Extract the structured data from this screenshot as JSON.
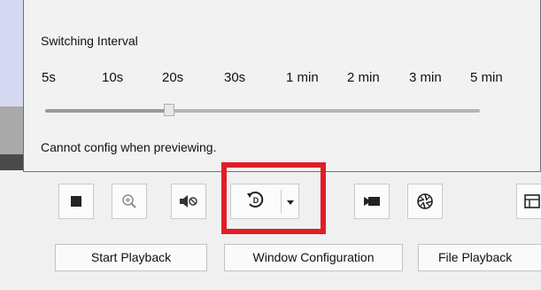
{
  "popup": {
    "title": "Switching Interval",
    "intervals": [
      "5s",
      "10s",
      "20s",
      "30s",
      "1 min",
      "2 min",
      "3 min",
      "5 min"
    ],
    "selected_interval": "20s",
    "hint": "Cannot config when previewing."
  },
  "toolbar": {
    "buttons": [
      {
        "name": "stop",
        "icon": "stop-icon"
      },
      {
        "name": "zoom",
        "icon": "zoom-in-icon"
      },
      {
        "name": "mute",
        "icon": "speaker-mute-icon"
      },
      {
        "name": "auto-switch",
        "icon": "auto-switch-icon"
      },
      {
        "name": "dropdown",
        "icon": "chevron-down-icon"
      },
      {
        "name": "camera",
        "icon": "camera-icon"
      },
      {
        "name": "aperture",
        "icon": "aperture-icon"
      },
      {
        "name": "layout",
        "icon": "window-layout-icon"
      }
    ],
    "highlight_color": "#e01e26"
  },
  "bottom": {
    "start_playback": "Start Playback",
    "window_configuration": "Window Configuration",
    "file_playback": "File Playback"
  }
}
